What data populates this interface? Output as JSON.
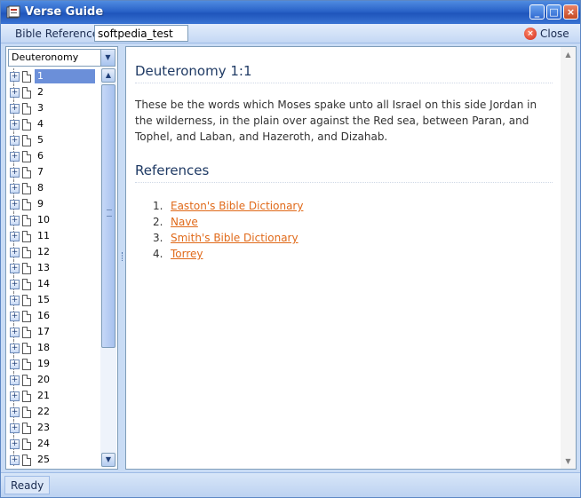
{
  "window": {
    "title": "Verse Guide",
    "buttons": {
      "minimize": "_",
      "maximize": "□",
      "close": "×"
    }
  },
  "toolbar": {
    "reference_label": "Bible Reference:",
    "reference_value": "softpedia_test",
    "close_label": "Close"
  },
  "navigator": {
    "book_selected": "Deuteronomy",
    "chapters": [
      "1",
      "2",
      "3",
      "4",
      "5",
      "6",
      "7",
      "8",
      "9",
      "10",
      "11",
      "12",
      "13",
      "14",
      "15",
      "16",
      "17",
      "18",
      "19",
      "20",
      "21",
      "22",
      "23",
      "24",
      "25"
    ],
    "selected_index": 0
  },
  "content": {
    "verse_title": "Deuteronomy 1:1",
    "verse_text": "These be the words which Moses spake unto all Israel on this side Jordan in the wilderness, in the plain over against the Red sea, between Paran, and Tophel, and Laban, and Hazeroth, and Dizahab.",
    "references_title": "References",
    "references": [
      {
        "num": "1.",
        "label": "Easton's Bible Dictionary"
      },
      {
        "num": "2.",
        "label": "Nave"
      },
      {
        "num": "3.",
        "label": "Smith's Bible Dictionary"
      },
      {
        "num": "4.",
        "label": "Torrey"
      }
    ]
  },
  "status": {
    "text": "Ready"
  },
  "icons": {
    "expander": "+",
    "scroll_up": "▲",
    "scroll_down": "▼",
    "combo_arrow": "▼"
  },
  "colors": {
    "titlebar": "#2a63c8",
    "selection": "#6b8fd9",
    "link": "#e06a1a",
    "heading": "#1f3a64"
  }
}
